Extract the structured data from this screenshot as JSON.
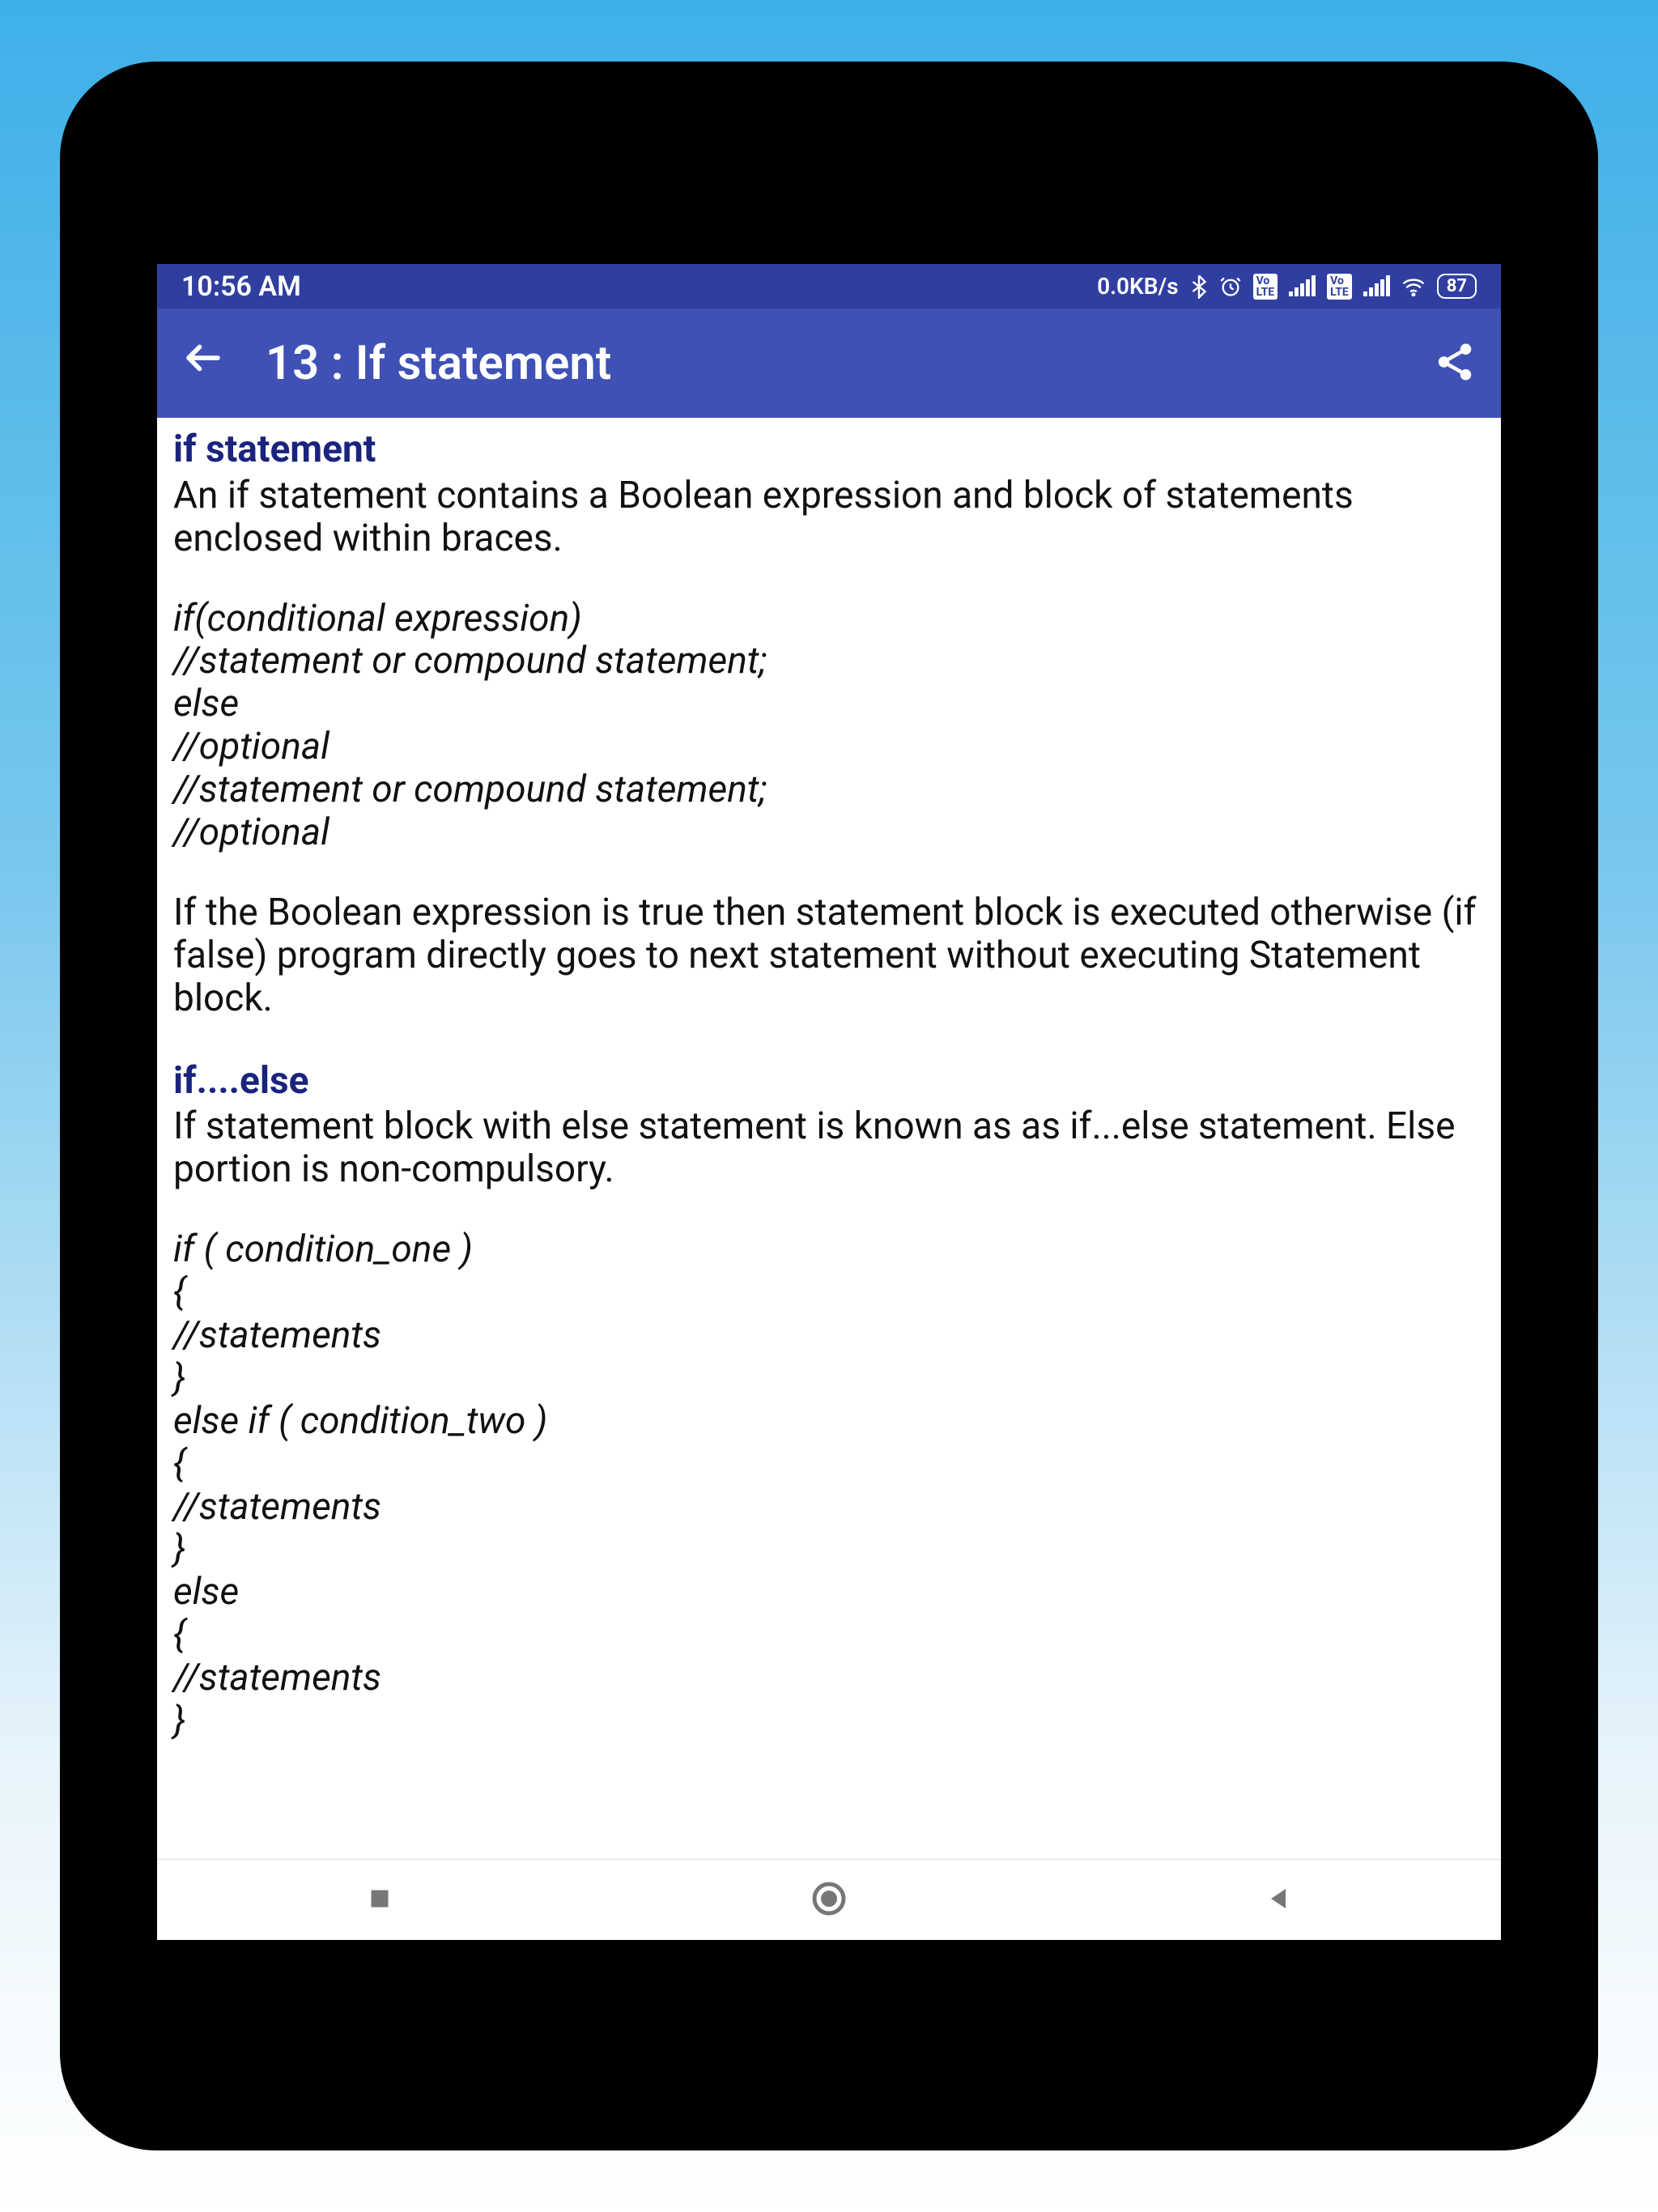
{
  "status_bar": {
    "time": "10:56 AM",
    "data_rate": "0.0KB/s",
    "battery_level": "87"
  },
  "app_bar": {
    "title": "13 :  If statement"
  },
  "content": {
    "section1_heading": "if statement",
    "section1_text": "An if statement contains a Boolean expression and block of statements enclosed within braces.",
    "code1_line1": "if(conditional expression)",
    "code1_line2": "//statement or compound statement;",
    "code1_line3": "else",
    "code1_line4": "//optional",
    "code1_line5": "//statement or compound statement;",
    "code1_line6": "//optional",
    "section1_text2": "If the Boolean expression is true then statement block is executed otherwise (if false) program directly goes to next statement without executing Statement block.",
    "section2_heading": "if....else",
    "section2_text": "If statement block with else statement is known as as if...else statement. Else portion is non-compulsory.",
    "code2_line1": "if ( condition_one )",
    "code2_line2": "{",
    "code2_line3": "//statements",
    "code2_line4": "}",
    "code2_line5": "else if ( condition_two )",
    "code2_line6": "{",
    "code2_line7": "//statements",
    "code2_line8": "}",
    "code2_line9": "else",
    "code2_line10": "{",
    "code2_line11": "//statements",
    "code2_line12": "}"
  }
}
